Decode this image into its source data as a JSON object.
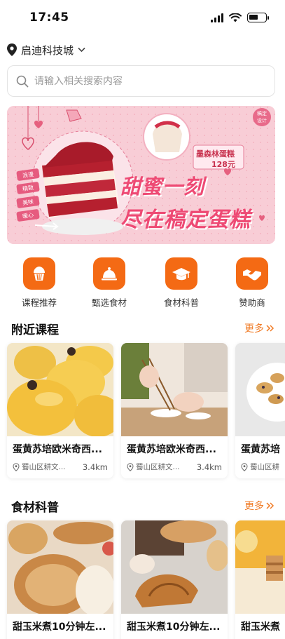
{
  "status_bar": {
    "time": "17:45"
  },
  "location": {
    "name": "启迪科技城"
  },
  "search": {
    "placeholder": "请输入相关搜索内容"
  },
  "banner": {
    "line1": "甜蜜一刻",
    "line2": "尽在稿定蛋糕",
    "product": "墨森林蛋糕",
    "price": "128元",
    "badge": "稿定设计",
    "side_tags": [
      "浪漫",
      "精致",
      "美味",
      "暖心"
    ]
  },
  "categories": [
    {
      "label": "课程推荐",
      "icon": "cupcake-icon"
    },
    {
      "label": "甄选食材",
      "icon": "cloche-icon"
    },
    {
      "label": "食材科普",
      "icon": "graduation-cap-icon"
    },
    {
      "label": "赞助商",
      "icon": "handshake-icon"
    }
  ],
  "nearby": {
    "title": "附近课程",
    "more": "更多",
    "cards": [
      {
        "title": "蛋黄苏培欧米奇西...",
        "address": "蜀山区耕文...",
        "distance": "3.4km"
      },
      {
        "title": "蛋黄苏培欧米奇西...",
        "address": "蜀山区耕文...",
        "distance": "3.4km"
      },
      {
        "title": "蛋黄苏培",
        "address": "蜀山区耕文",
        "distance": ""
      }
    ]
  },
  "ingredients": {
    "title": "食材科普",
    "more": "更多",
    "cards": [
      {
        "title": "甜玉米煮10分钟左..."
      },
      {
        "title": "甜玉米煮10分钟左..."
      },
      {
        "title": "甜玉米煮"
      }
    ]
  },
  "colors": {
    "accent": "#f46a14",
    "more_link": "#f07a24",
    "banner_bg": "#f6c7d0"
  }
}
